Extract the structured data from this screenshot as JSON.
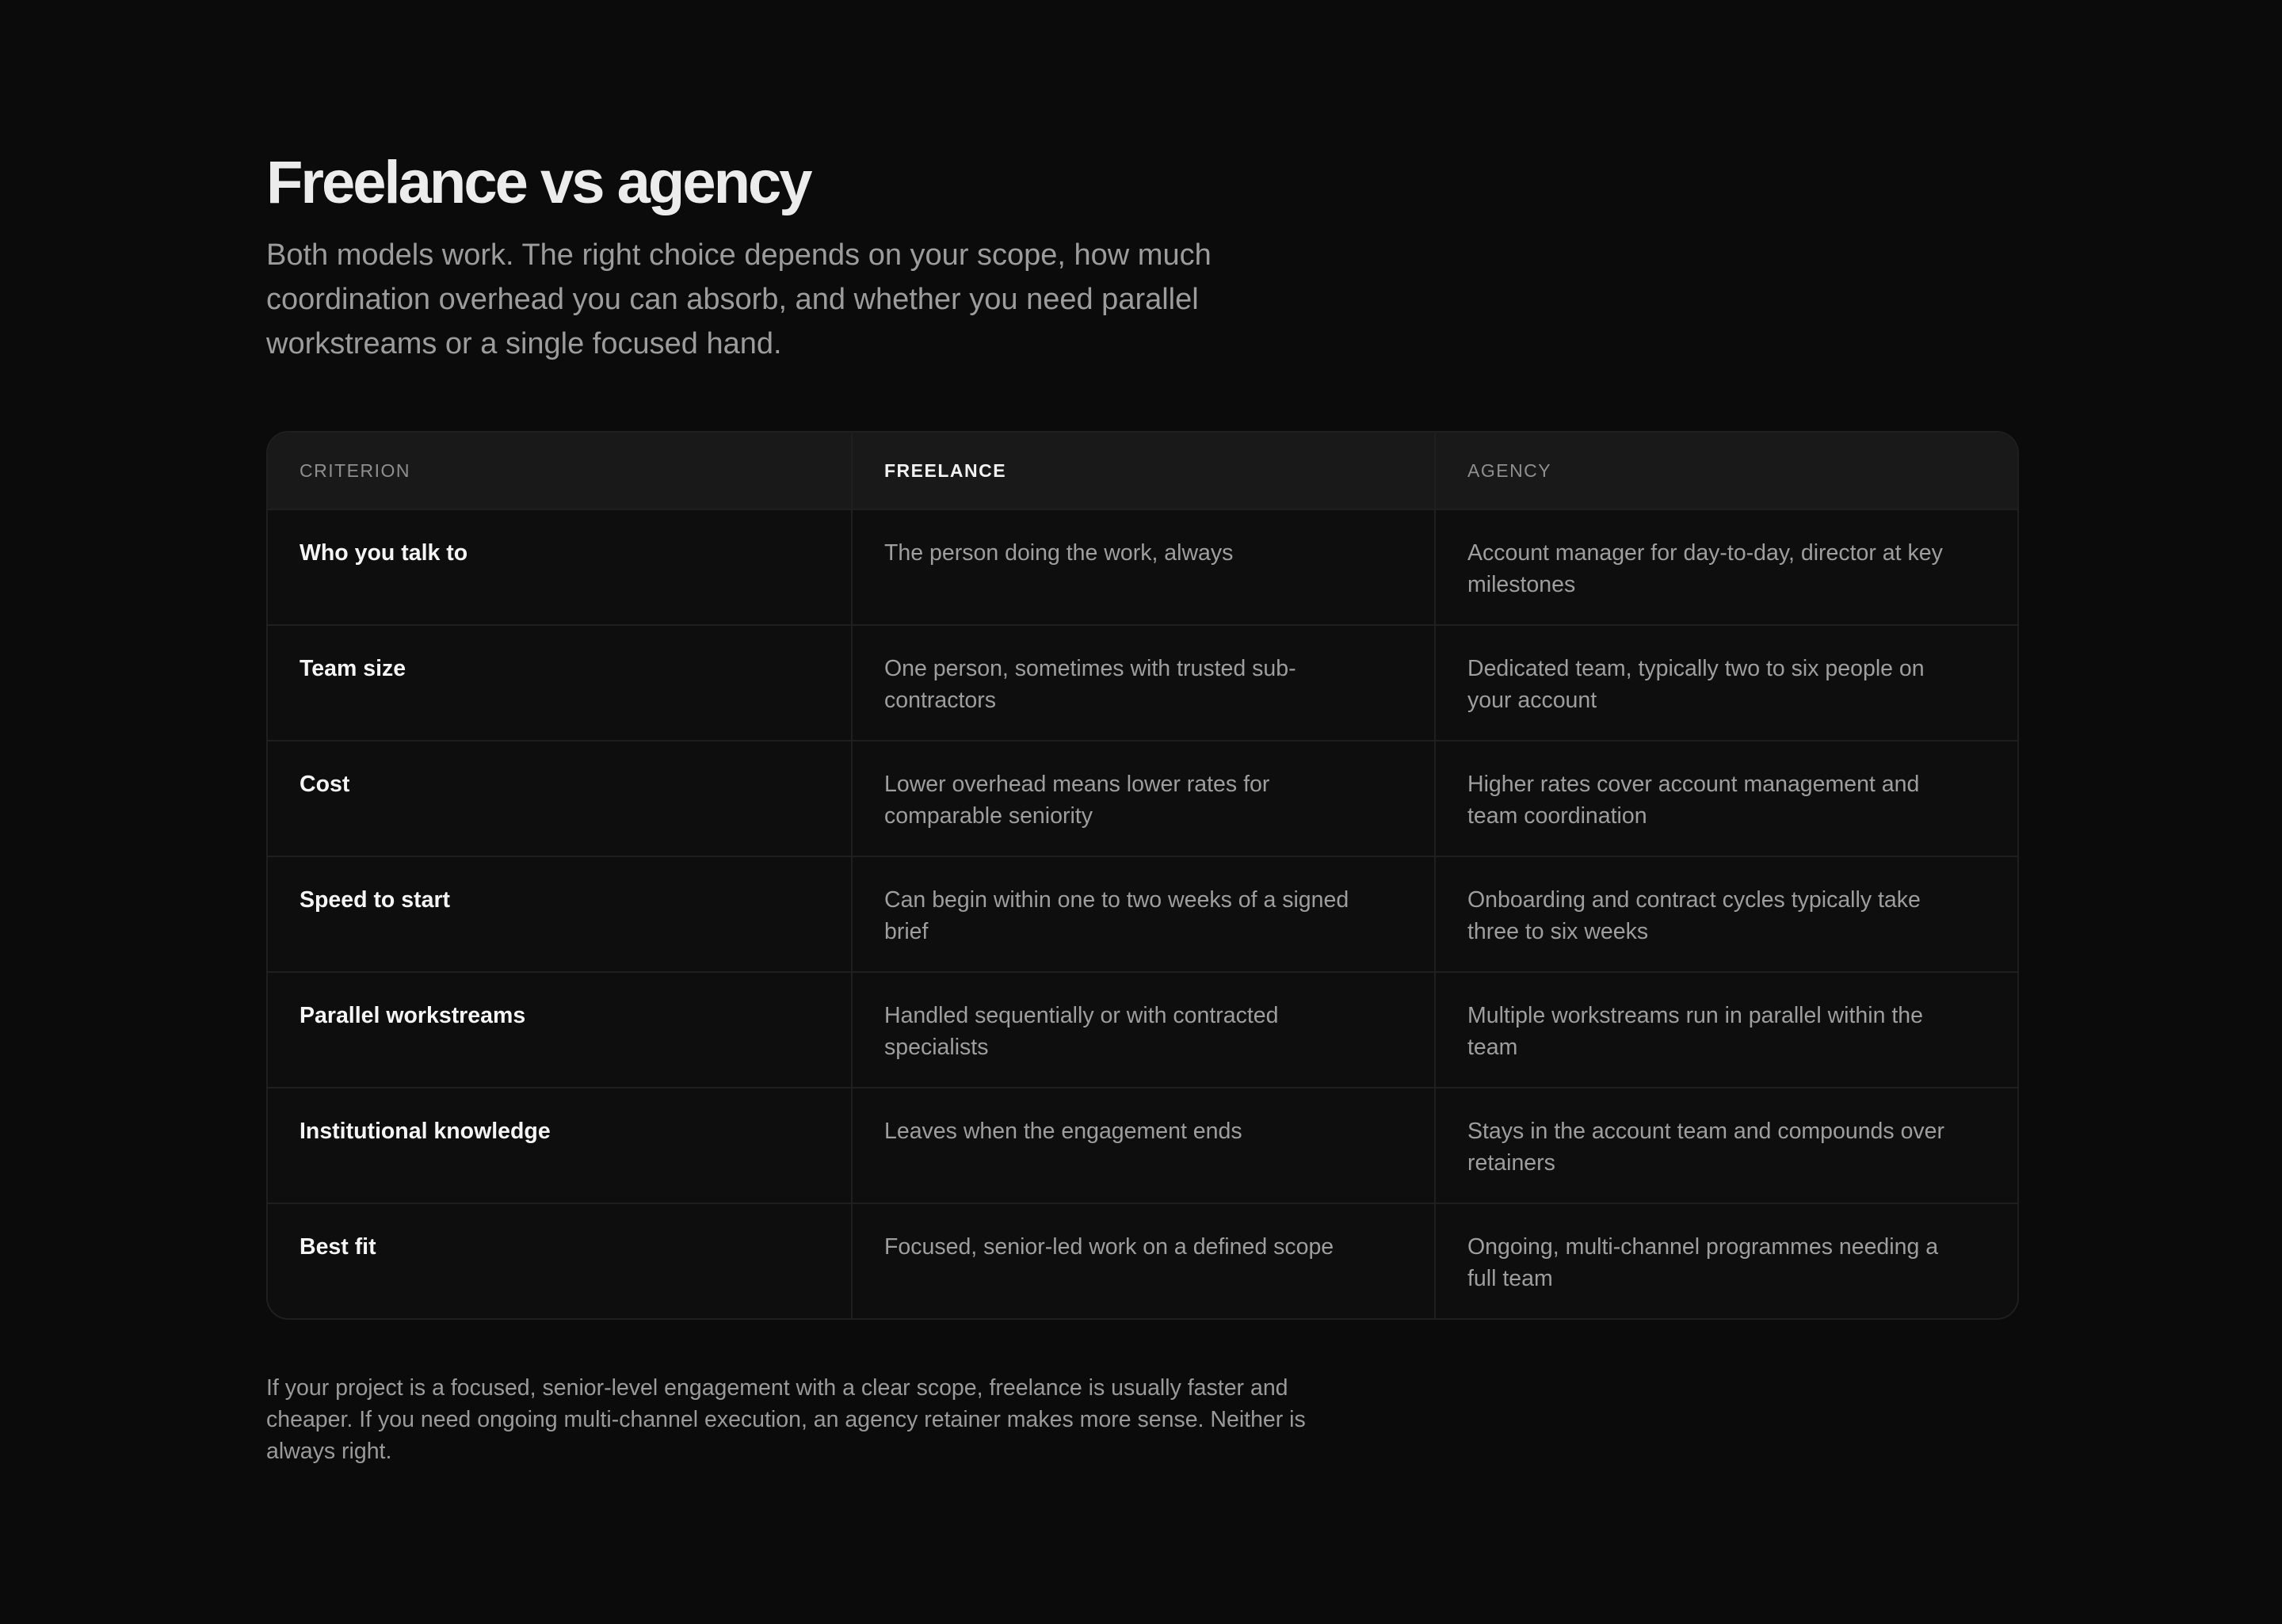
{
  "header": {
    "title": "Freelance vs agency",
    "lede": "Both models work. The right choice depends on your scope, how much coordination overhead you can absorb, and whether you need parallel workstreams or a single focused hand."
  },
  "table": {
    "columns": [
      "Criterion",
      "Freelance",
      "Agency"
    ],
    "rows": [
      {
        "criterion": "Who you talk to",
        "freelance": "The person doing the work, always",
        "agency": "Account manager for day-to-day, director at key milestones"
      },
      {
        "criterion": "Team size",
        "freelance": "One person, sometimes with trusted sub-contractors",
        "agency": "Dedicated team, typically two to six people on your account"
      },
      {
        "criterion": "Cost",
        "freelance": "Lower overhead means lower rates for comparable seniority",
        "agency": "Higher rates cover account management and team coordination"
      },
      {
        "criterion": "Speed to start",
        "freelance": "Can begin within one to two weeks of a signed brief",
        "agency": "Onboarding and contract cycles typically take three to six weeks"
      },
      {
        "criterion": "Parallel workstreams",
        "freelance": "Handled sequentially or with contracted specialists",
        "agency": "Multiple workstreams run in parallel within the team"
      },
      {
        "criterion": "Institutional knowledge",
        "freelance": "Leaves when the engagement ends",
        "agency": "Stays in the account team and compounds over retainers"
      },
      {
        "criterion": "Best fit",
        "freelance": "Focused, senior-led work on a defined scope",
        "agency": "Ongoing, multi-channel programmes needing a full team"
      }
    ]
  },
  "footnote": "If your project is a focused, senior-level engagement with a clear scope, freelance is usually faster and cheaper. If you need ongoing multi-channel execution, an agency retainer makes more sense. Neither is always right.",
  "colors": {
    "background": "#0b0b0b",
    "header_row": "#191919",
    "border": "#1f1f1f",
    "title": "#ececec",
    "body_text": "#9e9e9e",
    "label_text": "#f5f5f5"
  }
}
